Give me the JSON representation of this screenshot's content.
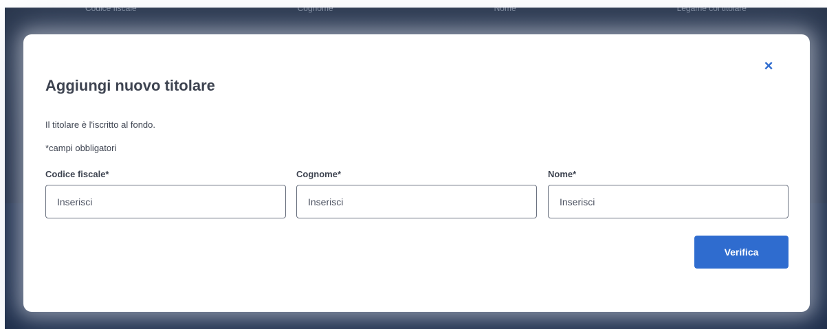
{
  "background": {
    "header_items": [
      "Codice fiscale",
      "Cognome",
      "Nome",
      "Legame col titolare"
    ]
  },
  "modal": {
    "close_icon": "×",
    "title": "Aggiungi nuovo titolare",
    "info_text": "Il titolare è l'iscritto al fondo.",
    "required_note": "*campi obbligatori",
    "fields": [
      {
        "label": "Codice fiscale*",
        "placeholder": "Inserisci",
        "value": ""
      },
      {
        "label": "Cognome*",
        "placeholder": "Inserisci",
        "value": ""
      },
      {
        "label": "Nome*",
        "placeholder": "Inserisci",
        "value": ""
      }
    ],
    "verify_label": "Verifica"
  },
  "colors": {
    "accent": "#2f6ccf",
    "text": "#3d4350",
    "overlay": "#1c2940"
  },
  "icons": {
    "close": "close-icon"
  }
}
